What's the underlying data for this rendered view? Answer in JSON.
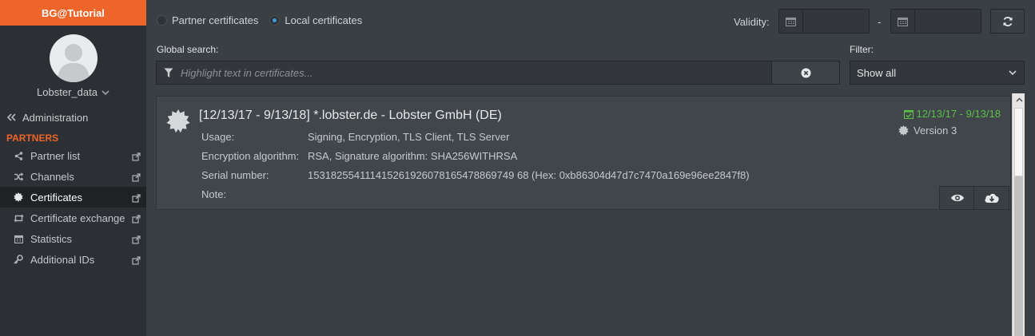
{
  "app": {
    "title": "BG@Tutorial"
  },
  "user": {
    "name": "Lobster_data"
  },
  "sidebar": {
    "admin_label": "Administration",
    "section_title": "PARTNERS",
    "items": [
      {
        "label": "Partner list",
        "icon": "share-icon"
      },
      {
        "label": "Channels",
        "icon": "shuffle-icon"
      },
      {
        "label": "Certificates",
        "icon": "certificate-icon",
        "active": true
      },
      {
        "label": "Certificate exchange",
        "icon": "retweet-icon"
      },
      {
        "label": "Statistics",
        "icon": "calendar-icon"
      },
      {
        "label": "Additional IDs",
        "icon": "key-icon"
      }
    ]
  },
  "toolbar": {
    "radio_partner": "Partner certificates",
    "radio_local": "Local certificates",
    "selected": "Local certificates",
    "validity_label": "Validity:",
    "date_from": "",
    "date_to": "",
    "date_dash": "-"
  },
  "search": {
    "label": "Global search:",
    "placeholder": "Highlight text in certificates...",
    "value": ""
  },
  "filter": {
    "label": "Filter:",
    "selected": "Show all"
  },
  "certificate": {
    "title": "[12/13/17 - 9/13/18] *.lobster.de - Lobster GmbH (DE)",
    "validity": "12/13/17 - 9/13/18",
    "version": "Version 3",
    "fields": [
      {
        "key": "Usage:",
        "value": "Signing, Encryption, TLS Client, TLS Server"
      },
      {
        "key": "Encryption algorithm:",
        "value": "RSA, Signature algorithm: SHA256WITHRSA"
      },
      {
        "key": "Serial number:",
        "value": "153182554111415261926078165478869749 68 (Hex: 0xb86304d47d7c7470a169e96ee2847f8)"
      },
      {
        "key": "Note:",
        "value": ""
      }
    ]
  },
  "colors": {
    "accent": "#ed6528",
    "valid": "#5bbf4a",
    "radio_selected": "#3c9bd6"
  }
}
